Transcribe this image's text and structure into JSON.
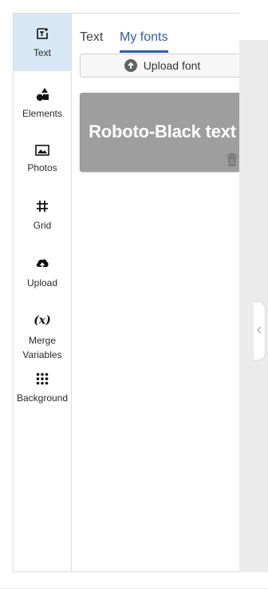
{
  "sidebar": {
    "items": [
      {
        "label": "Text",
        "icon": "text-box-icon",
        "active": true
      },
      {
        "label": "Elements",
        "icon": "shapes-icon",
        "active": false
      },
      {
        "label": "Photos",
        "icon": "photo-icon",
        "active": false
      },
      {
        "label": "Grid",
        "icon": "grid-icon",
        "active": false
      },
      {
        "label": "Upload",
        "icon": "cloud-upload-icon",
        "active": false
      },
      {
        "label": "Merge Variables",
        "line1": "Merge",
        "line2": "Variables",
        "icon": "variable-icon",
        "icon_text": "(x)",
        "active": false
      },
      {
        "label": "Background",
        "icon": "dots-grid-icon",
        "active": false
      }
    ]
  },
  "panel": {
    "tabs": [
      {
        "label": "Text",
        "active": false
      },
      {
        "label": "My fonts",
        "active": true
      }
    ],
    "upload_button_label": "Upload font",
    "fonts": [
      {
        "preview_text": "Roboto-Black text",
        "icon": "trash-icon"
      }
    ]
  },
  "colors": {
    "accent": "#2f5f9f",
    "active_item_bg": "#d7e7f5",
    "card_bg": "#9e9e9e"
  }
}
